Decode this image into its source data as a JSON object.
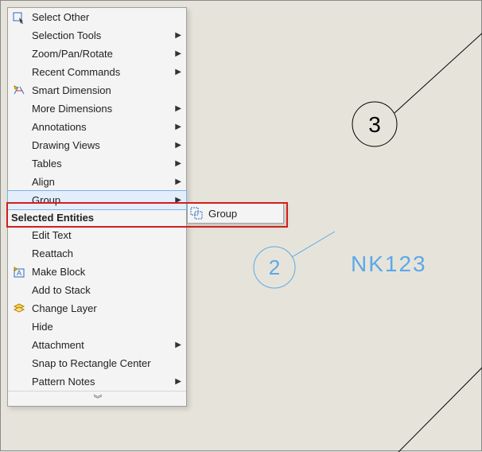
{
  "menu": {
    "items": [
      {
        "label": "Select Other",
        "icon": "select-other",
        "submenu": false
      },
      {
        "label": "Selection Tools",
        "icon": "",
        "submenu": true
      },
      {
        "label": "Zoom/Pan/Rotate",
        "icon": "",
        "submenu": true
      },
      {
        "label": "Recent Commands",
        "icon": "",
        "submenu": true
      },
      {
        "label": "Smart Dimension",
        "icon": "smart-dimension",
        "submenu": false
      },
      {
        "label": "More Dimensions",
        "icon": "",
        "submenu": true
      },
      {
        "label": "Annotations",
        "icon": "",
        "submenu": true
      },
      {
        "label": "Drawing Views",
        "icon": "",
        "submenu": true
      },
      {
        "label": "Tables",
        "icon": "",
        "submenu": true
      },
      {
        "label": "Align",
        "icon": "",
        "submenu": true
      },
      {
        "label": "Group",
        "icon": "",
        "submenu": true,
        "hover": true
      }
    ],
    "section_label": "Selected Entities",
    "items2": [
      {
        "label": "Edit Text",
        "icon": "",
        "submenu": false
      },
      {
        "label": "Reattach",
        "icon": "",
        "submenu": false
      },
      {
        "label": "Make Block",
        "icon": "make-block",
        "submenu": false
      },
      {
        "label": "Add to Stack",
        "icon": "",
        "submenu": false
      },
      {
        "label": "Change Layer",
        "icon": "change-layer",
        "submenu": false
      },
      {
        "label": "Hide",
        "icon": "",
        "submenu": false
      },
      {
        "label": "Attachment",
        "icon": "",
        "submenu": true
      },
      {
        "label": "Snap to Rectangle Center",
        "icon": "",
        "submenu": false
      },
      {
        "label": "Pattern Notes",
        "icon": "",
        "submenu": true
      }
    ]
  },
  "submenu": {
    "label": "Group",
    "icon": "group"
  },
  "canvas": {
    "balloon3": {
      "text": "3"
    },
    "balloon2": {
      "text": "2"
    },
    "note": "NK123"
  }
}
